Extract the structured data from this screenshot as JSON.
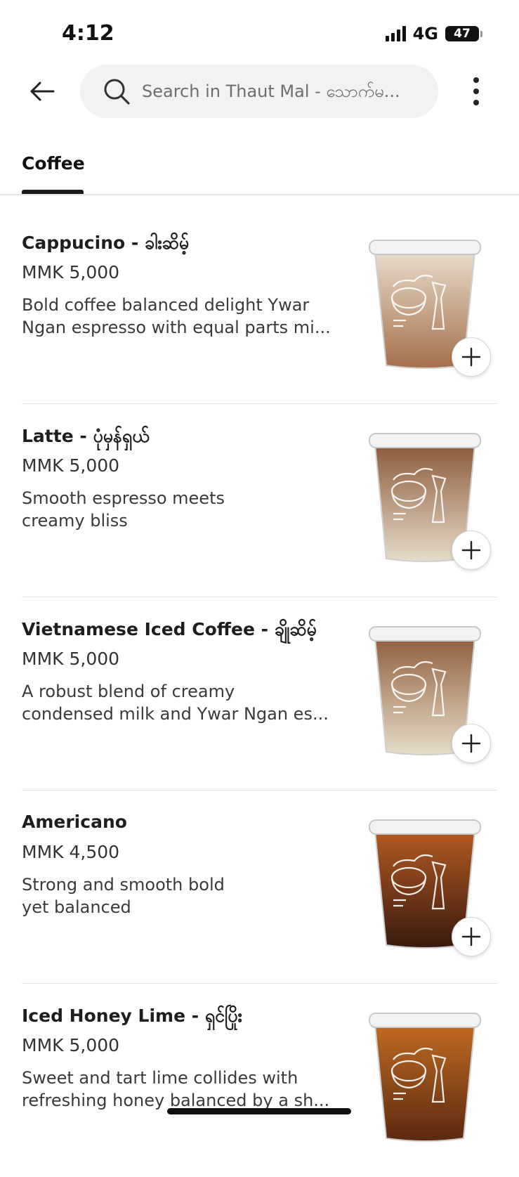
{
  "status_bar": {
    "time": "4:12",
    "network": "4G",
    "battery": "47"
  },
  "search": {
    "placeholder": "Search in Thaut Mal - သောက်မ..."
  },
  "tabs": [
    {
      "label": "Coffee",
      "active": true
    }
  ],
  "items": [
    {
      "name": "Cappucino - ခါးဆိမ့်",
      "price": "MMK 5,000",
      "description": "Bold coffee balanced delight Ywar\nNgan espresso with equal parts mi...",
      "drink_colors": {
        "top": "#e8dccd",
        "bottom": "#a4704a"
      }
    },
    {
      "name": "Latte - ပုံမှန်ရှယ်",
      "price": "MMK 5,000",
      "description": "Smooth espresso meets\ncreamy bliss",
      "drink_colors": {
        "top": "#8c5a3a",
        "bottom": "#e6dccb"
      }
    },
    {
      "name": "Vietnamese Iced Coffee - ချိုဆိမ့်",
      "price": "MMK 5,000",
      "description": "A robust blend of creamy\ncondensed milk and Ywar Ngan es...",
      "drink_colors": {
        "top": "#91603f",
        "bottom": "#e6ddc9"
      }
    },
    {
      "name": "Americano",
      "price": "MMK 4,500",
      "description": "Strong and smooth bold\nyet balanced",
      "drink_colors": {
        "top": "#b35a22",
        "bottom": "#3a1a0e"
      }
    },
    {
      "name": "Iced Honey Lime -  ရှင်ပြိုး",
      "price": "MMK 5,000",
      "description": "Sweet and tart lime collides with\nrefreshing honey balanced by a sh...",
      "drink_colors": {
        "top": "#c06a22",
        "bottom": "#5a2a10"
      }
    }
  ]
}
